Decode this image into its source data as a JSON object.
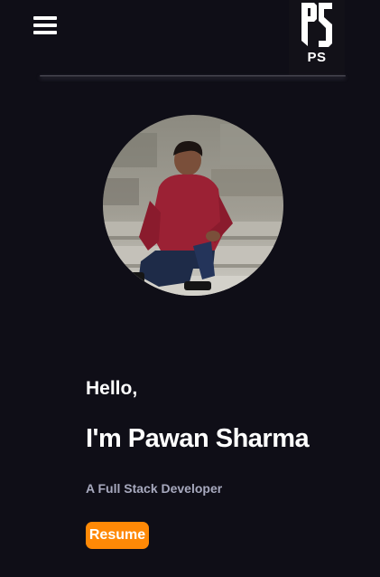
{
  "header": {
    "menu_icon": "hamburger-menu-icon",
    "logo_text": "PS"
  },
  "hero": {
    "avatar_alt": "profile-photo",
    "greeting": "Hello,",
    "name": "I'm Pawan Sharma",
    "role": "A Full Stack Developer",
    "resume_label": "Resume"
  },
  "colors": {
    "background": "#0f0e17",
    "accent": "#ff8906",
    "text": "#ffffff",
    "muted_text": "#a7a9be"
  }
}
